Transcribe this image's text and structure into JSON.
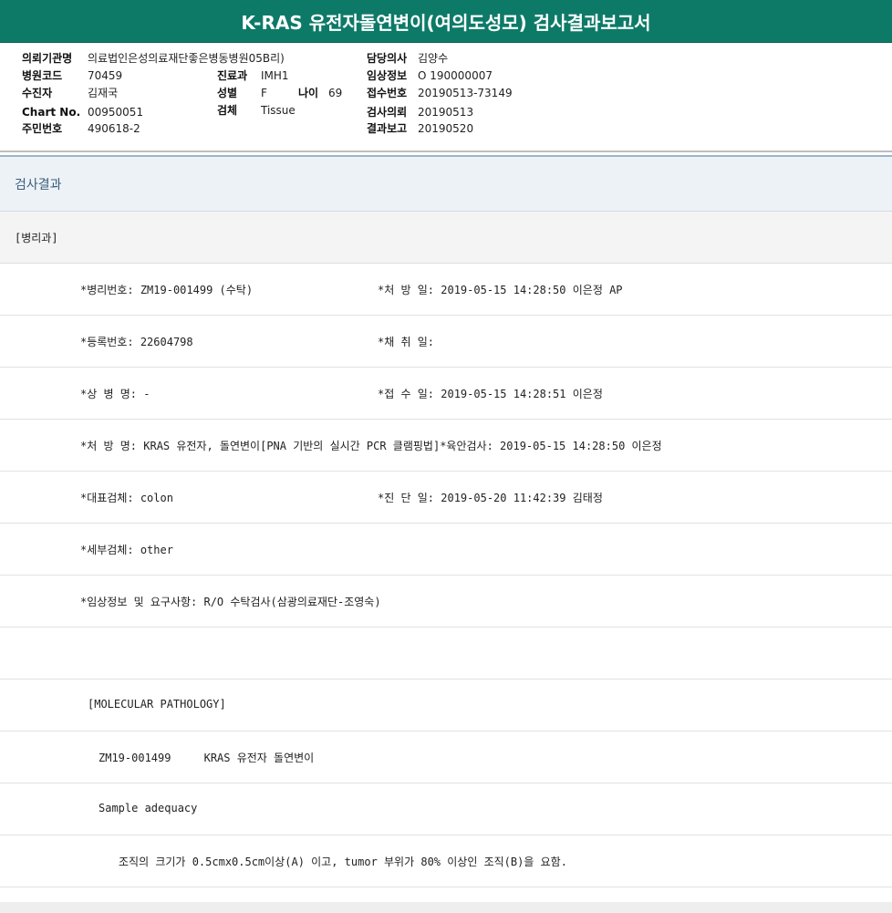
{
  "title": "K-RAS 유전자돌연변이(여의도성모) 검사결과보고서",
  "header": {
    "requesting_org": {
      "label": "의뢰기관명",
      "value": "의료법인은성의료재단좋은병동병원05B리)"
    },
    "hospital_code": {
      "label": "병원코드",
      "value": "70459"
    },
    "patient": {
      "label": "수진자",
      "value": "김재국"
    },
    "chart_no": {
      "label": "Chart No.",
      "value": "00950051"
    },
    "resident_no": {
      "label": "주민번호",
      "value": "490618-2"
    },
    "department": {
      "label": "진료과",
      "value": "IMH1"
    },
    "sex": {
      "label": "성별",
      "value": "F"
    },
    "age": {
      "label": "나이",
      "value": "69"
    },
    "specimen": {
      "label": "검체",
      "value": "Tissue"
    },
    "doctor": {
      "label": "담당의사",
      "value": "김양수"
    },
    "clinical_info": {
      "label": "임상정보",
      "value": "O 190000007"
    },
    "receipt_no": {
      "label": "접수번호",
      "value": "20190513-73149"
    },
    "test_request": {
      "label": "검사의뢰",
      "value": "20190513"
    },
    "result_report": {
      "label": "결과보고",
      "value": "20190520"
    }
  },
  "section_title": "검사결과",
  "dept_title": "[병리과]",
  "rows": {
    "pathology_no": "*병리번호: ZM19-001499 (수탁)",
    "prescription_date": "*처 방 일: 2019-05-15 14:28:50  이은정 AP",
    "registration_no": "*등록번호: 22604798",
    "collection_date": "*채 취 일:",
    "disease_name": "*상 병 명: -",
    "receipt_date": "*접 수 일: 2019-05-15 14:28:51  이은정",
    "prescription_name": "*처 방 명: KRAS 유전자, 돌연변이[PNA 기반의 실시간 PCR 클램핑법]*육안검사: 2019-05-15 14:28:50  이은정",
    "main_specimen": "*대표검체: colon",
    "diagnosis_date": "*진 단 일: 2019-05-20 11:42:39  김태정",
    "sub_specimen": "*세부검체: other",
    "clinical_request": "*임상정보 및 요구사항: R/O 수탁검사(삼광의료재단-조영숙)",
    "molecular_header": "[MOLECULAR PATHOLOGY]",
    "test_id": "ZM19-001499     KRAS 유전자 돌연변이",
    "sample_adequacy": "Sample adequacy",
    "adequacy_note": "조직의 크기가 0.5cmx0.5cm이상(A) 이고, tumor 부위가 80% 이상인 조직(B)을 요함."
  }
}
